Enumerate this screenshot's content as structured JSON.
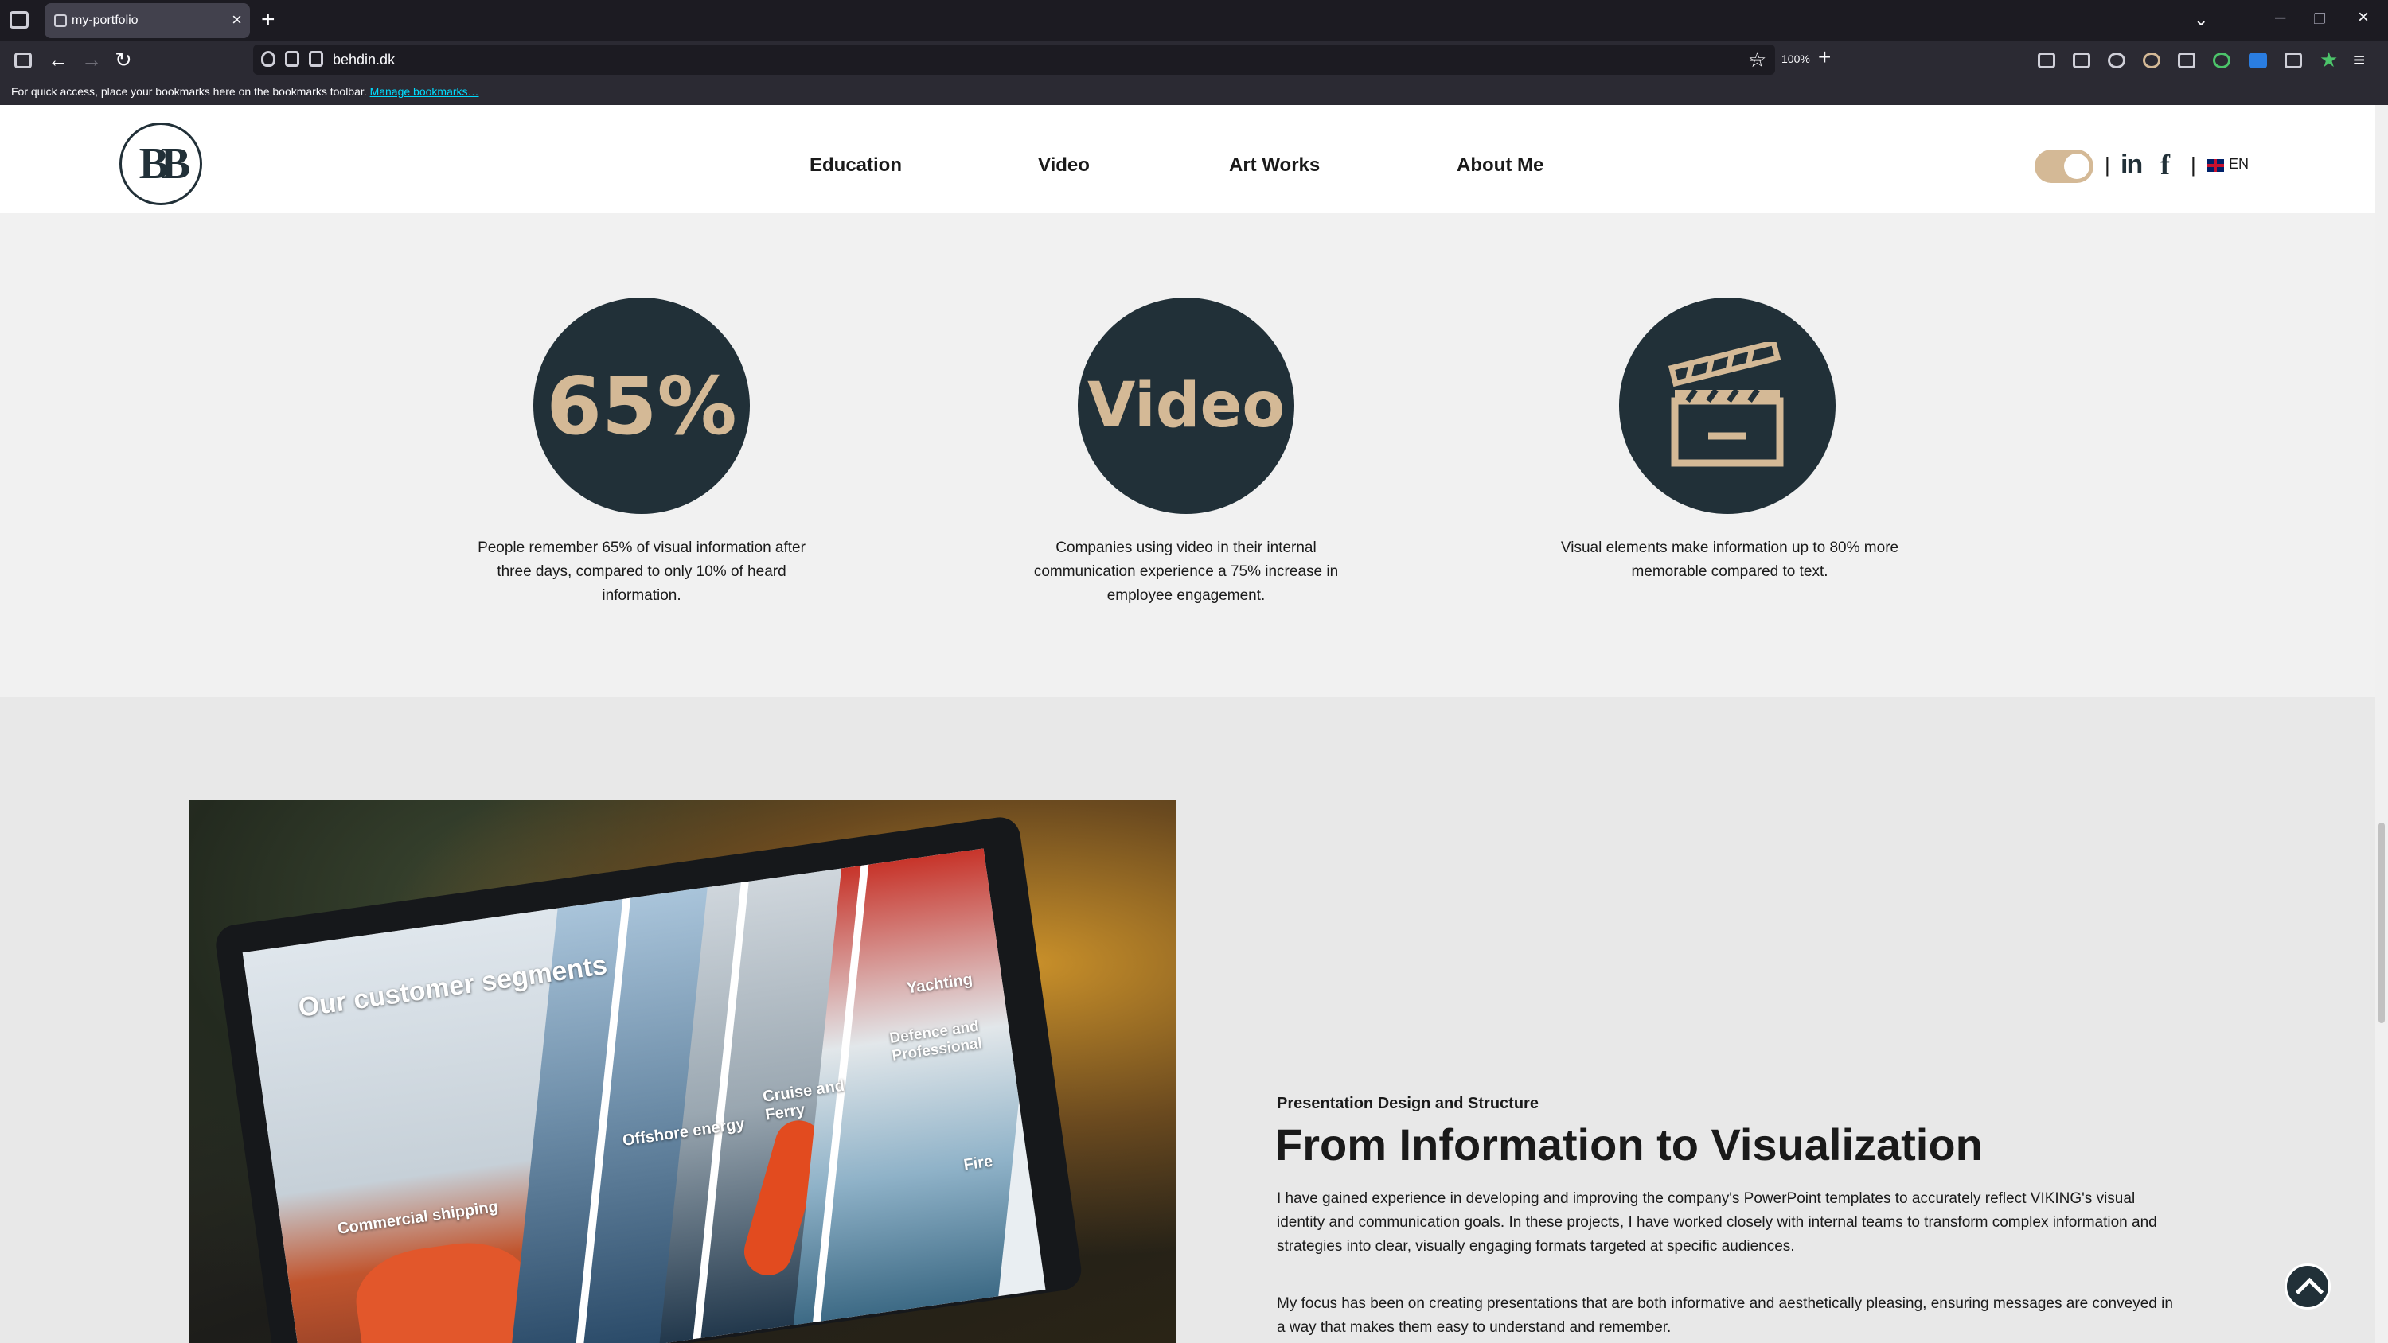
{
  "browser": {
    "tab_title": "my-portfolio",
    "url": "behdin.dk",
    "zoom": "100%",
    "bookmarks_hint": "For quick access, place your bookmarks here on the bookmarks toolbar.",
    "manage_bookmarks": "Manage bookmarks…"
  },
  "header": {
    "menu": [
      "Education",
      "Video",
      "Art Works",
      "About Me"
    ],
    "linkedin": "in",
    "facebook": "f",
    "language": "EN",
    "separator": "|",
    "theme_toggle_on": true
  },
  "stats": [
    {
      "badge": "65%",
      "text": "People remember 65% of visual information after three days, compared to only 10% of heard information."
    },
    {
      "badge": "Video",
      "text": "Companies using video in their internal communication experience a 75% increase in employee engagement."
    },
    {
      "icon": "clapperboard-icon",
      "text": "Visual elements make information up to 80% more memorable compared to text."
    }
  ],
  "feature": {
    "image_labels": {
      "title": "Our customer segments",
      "commercial": "Commercial shipping",
      "offshore": "Offshore energy",
      "cruise": "Cruise and Ferry",
      "yachting": "Yachting",
      "defence": "Defence and Professional",
      "fire": "Fire"
    },
    "eyebrow": "Presentation Design and Structure",
    "headline": "From Information to Visualization",
    "paragraphs": [
      "I have gained experience in developing and improving the company's PowerPoint templates to accurately reflect VIKING's visual identity and communication goals. In these projects, I have worked closely with internal teams to transform complex information and strategies into clear, visually engaging formats targeted at specific audiences.",
      "My focus has been on creating presentations that are both informative and aesthetically pleasing, ensuring messages are conveyed in a way that makes them easy to understand and remember."
    ]
  },
  "colors": {
    "navy": "#213038",
    "gold": "#d4b996"
  }
}
